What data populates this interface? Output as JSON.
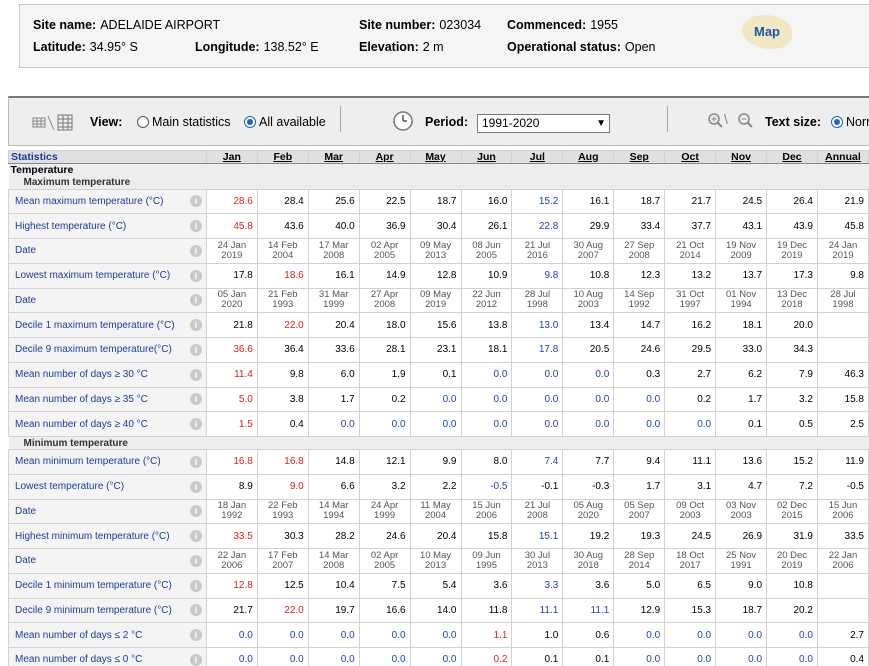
{
  "site": {
    "name_label": "Site name:",
    "name": "ADELAIDE AIRPORT",
    "number_label": "Site number:",
    "number": "023034",
    "commenced_label": "Commenced:",
    "commenced": "1955",
    "lat_label": "Latitude:",
    "lat": "34.95° S",
    "lon_label": "Longitude:",
    "lon": "138.52° E",
    "elev_label": "Elevation:",
    "elev": "2 m",
    "status_label": "Operational status:",
    "status": "Open",
    "map_label": "Map"
  },
  "toolbar": {
    "view_label": "View:",
    "view_main": "Main statistics",
    "view_all": "All available",
    "period_label": "Period:",
    "period_value": "1991-2020",
    "text_size_label": "Text size:",
    "text_size_option": "Norm"
  },
  "table": {
    "stat_header": "Statistics",
    "months": [
      "Jan",
      "Feb",
      "Mar",
      "Apr",
      "May",
      "Jun",
      "Jul",
      "Aug",
      "Sep",
      "Oct",
      "Nov",
      "Dec",
      "Annual"
    ],
    "group": "Temperature",
    "sections": [
      {
        "title": "Maximum temperature",
        "rows": [
          {
            "label": "Mean maximum temperature (°C)",
            "type": "v",
            "values": [
              "28.6",
              "28.4",
              "25.6",
              "22.5",
              "18.7",
              "16.0",
              "15.2",
              "16.1",
              "18.7",
              "21.7",
              "24.5",
              "26.4",
              "21.9"
            ],
            "colors": [
              "red",
              "",
              "",
              "",
              "",
              "",
              "blue",
              "",
              "",
              "",
              "",
              "",
              ""
            ]
          },
          {
            "label": "Highest temperature (°C)",
            "type": "v",
            "values": [
              "45.8",
              "43.6",
              "40.0",
              "36.9",
              "30.4",
              "26.1",
              "22.8",
              "29.9",
              "33.4",
              "37.7",
              "43.1",
              "43.9",
              "45.8"
            ],
            "colors": [
              "red",
              "",
              "",
              "",
              "",
              "",
              "blue",
              "",
              "",
              "",
              "",
              "",
              ""
            ]
          },
          {
            "label": "Date",
            "type": "d",
            "values": [
              "24 Jan\n2019",
              "14 Feb\n2004",
              "17 Mar\n2008",
              "02 Apr\n2005",
              "09 May\n2013",
              "08 Jun\n2005",
              "21 Jul\n2016",
              "30 Aug\n2007",
              "27 Sep\n2008",
              "21 Oct\n2014",
              "19 Nov\n2009",
              "19 Dec\n2019",
              "24 Jan\n2019"
            ]
          },
          {
            "label": "Lowest maximum temperature (°C)",
            "type": "v",
            "values": [
              "17.8",
              "18.6",
              "16.1",
              "14.9",
              "12.8",
              "10.9",
              "9.8",
              "10.8",
              "12.3",
              "13.2",
              "13.7",
              "17.3",
              "9.8"
            ],
            "colors": [
              "",
              "red",
              "",
              "",
              "",
              "",
              "blue",
              "",
              "",
              "",
              "",
              "",
              ""
            ]
          },
          {
            "label": "Date",
            "type": "d",
            "values": [
              "05 Jan\n2020",
              "21 Feb\n1993",
              "31 Mar\n1999",
              "27 Apr\n2008",
              "09 May\n2019",
              "22 Jun\n2012",
              "28 Jul\n1998",
              "10 Aug\n2003",
              "14 Sep\n1992",
              "31 Oct\n1997",
              "01 Nov\n1994",
              "13 Dec\n2018",
              "28 Jul\n1998"
            ]
          },
          {
            "label": "Decile 1 maximum temperature (°C)",
            "type": "v",
            "values": [
              "21.8",
              "22.0",
              "20.4",
              "18.0",
              "15.6",
              "13.8",
              "13.0",
              "13.4",
              "14.7",
              "16.2",
              "18.1",
              "20.0",
              ""
            ],
            "colors": [
              "",
              "red",
              "",
              "",
              "",
              "",
              "blue",
              "",
              "",
              "",
              "",
              "",
              ""
            ]
          },
          {
            "label": "Decile 9 maximum temperature(°C)",
            "type": "v",
            "values": [
              "36.6",
              "36.4",
              "33.6",
              "28.1",
              "23.1",
              "18.1",
              "17.8",
              "20.5",
              "24.6",
              "29.5",
              "33.0",
              "34.3",
              ""
            ],
            "colors": [
              "red",
              "",
              "",
              "",
              "",
              "",
              "blue",
              "",
              "",
              "",
              "",
              "",
              ""
            ]
          },
          {
            "label": "Mean number of days ≥ 30 °C",
            "type": "v",
            "values": [
              "11.4",
              "9.8",
              "6.0",
              "1.9",
              "0.1",
              "0.0",
              "0.0",
              "0.0",
              "0.3",
              "2.7",
              "6.2",
              "7.9",
              "46.3"
            ],
            "colors": [
              "red",
              "",
              "",
              "",
              "",
              "blue",
              "blue",
              "blue",
              "",
              "",
              "",
              "",
              ""
            ]
          },
          {
            "label": "Mean number of days ≥ 35 °C",
            "type": "v",
            "values": [
              "5.0",
              "3.8",
              "1.7",
              "0.2",
              "0.0",
              "0.0",
              "0.0",
              "0.0",
              "0.0",
              "0.2",
              "1.7",
              "3.2",
              "15.8"
            ],
            "colors": [
              "red",
              "",
              "",
              "",
              "blue",
              "blue",
              "blue",
              "blue",
              "blue",
              "",
              "",
              "",
              ""
            ]
          },
          {
            "label": "Mean number of days ≥ 40 °C",
            "type": "v",
            "values": [
              "1.5",
              "0.4",
              "0.0",
              "0.0",
              "0.0",
              "0.0",
              "0.0",
              "0.0",
              "0.0",
              "0.0",
              "0.1",
              "0.5",
              "2.5"
            ],
            "colors": [
              "red",
              "",
              "blue",
              "blue",
              "blue",
              "blue",
              "blue",
              "blue",
              "blue",
              "blue",
              "",
              "",
              ""
            ]
          }
        ]
      },
      {
        "title": "Minimum temperature",
        "rows": [
          {
            "label": "Mean minimum temperature (°C)",
            "type": "v",
            "values": [
              "16.8",
              "16.8",
              "14.8",
              "12.1",
              "9.9",
              "8.0",
              "7.4",
              "7.7",
              "9.4",
              "11.1",
              "13.6",
              "15.2",
              "11.9"
            ],
            "colors": [
              "red",
              "red",
              "",
              "",
              "",
              "",
              "blue",
              "",
              "",
              "",
              "",
              "",
              ""
            ]
          },
          {
            "label": "Lowest temperature (°C)",
            "type": "v",
            "values": [
              "8.9",
              "9.0",
              "6.6",
              "3.2",
              "2.2",
              "-0.5",
              "-0.1",
              "-0.3",
              "1.7",
              "3.1",
              "4.7",
              "7.2",
              "-0.5"
            ],
            "colors": [
              "",
              "red",
              "",
              "",
              "",
              "blue",
              "",
              "",
              "",
              "",
              "",
              "",
              ""
            ]
          },
          {
            "label": "Date",
            "type": "d",
            "values": [
              "18 Jan\n1992",
              "22 Feb\n1993",
              "14 Mar\n1994",
              "24 Apr\n1999",
              "11 May\n2004",
              "15 Jun\n2006",
              "21 Jul\n2008",
              "05 Aug\n2020",
              "05 Sep\n2007",
              "09 Oct\n2003",
              "03 Nov\n2003",
              "02 Dec\n2015",
              "15 Jun\n2006"
            ]
          },
          {
            "label": "Highest minimum temperature (°C)",
            "type": "v",
            "values": [
              "33.5",
              "30.3",
              "28.2",
              "24.6",
              "20.4",
              "15.8",
              "15.1",
              "19.2",
              "19.3",
              "24.5",
              "26.9",
              "31.9",
              "33.5"
            ],
            "colors": [
              "red",
              "",
              "",
              "",
              "",
              "",
              "blue",
              "",
              "",
              "",
              "",
              "",
              ""
            ]
          },
          {
            "label": "Date",
            "type": "d",
            "values": [
              "22 Jan\n2006",
              "17 Feb\n2007",
              "14 Mar\n2008",
              "02 Apr\n2005",
              "10 May\n2013",
              "09 Jun\n1995",
              "30 Jul\n2013",
              "30 Aug\n2018",
              "28 Sep\n2014",
              "18 Oct\n2017",
              "25 Nov\n1991",
              "20 Dec\n2019",
              "22 Jan\n2006"
            ]
          },
          {
            "label": "Decile 1 minimum temperature (°C)",
            "type": "v",
            "values": [
              "12.8",
              "12.5",
              "10.4",
              "7.5",
              "5.4",
              "3.6",
              "3.3",
              "3.6",
              "5.0",
              "6.5",
              "9.0",
              "10.8",
              ""
            ],
            "colors": [
              "red",
              "",
              "",
              "",
              "",
              "",
              "blue",
              "",
              "",
              "",
              "",
              "",
              ""
            ]
          },
          {
            "label": "Decile 9 minimum temperature (°C)",
            "type": "v",
            "values": [
              "21.7",
              "22.0",
              "19.7",
              "16.6",
              "14.0",
              "11.8",
              "11.1",
              "11.1",
              "12.9",
              "15.3",
              "18.7",
              "20.2",
              ""
            ],
            "colors": [
              "",
              "red",
              "",
              "",
              "",
              "",
              "blue",
              "blue",
              "",
              "",
              "",
              "",
              ""
            ]
          },
          {
            "label": "Mean number of days ≤ 2 °C",
            "type": "v",
            "values": [
              "0.0",
              "0.0",
              "0.0",
              "0.0",
              "0.0",
              "1.1",
              "1.0",
              "0.6",
              "0.0",
              "0.0",
              "0.0",
              "0.0",
              "2.7"
            ],
            "colors": [
              "blue",
              "blue",
              "blue",
              "blue",
              "blue",
              "red",
              "",
              "",
              "blue",
              "blue",
              "blue",
              "blue",
              ""
            ]
          },
          {
            "label": "Mean number of days ≤ 0 °C",
            "type": "v",
            "values": [
              "0.0",
              "0.0",
              "0.0",
              "0.0",
              "0.0",
              "0.2",
              "0.1",
              "0.1",
              "0.0",
              "0.0",
              "0.0",
              "0.0",
              "0.4"
            ],
            "colors": [
              "blue",
              "blue",
              "blue",
              "blue",
              "blue",
              "red",
              "",
              "",
              "blue",
              "blue",
              "blue",
              "blue",
              ""
            ]
          }
        ]
      }
    ]
  }
}
